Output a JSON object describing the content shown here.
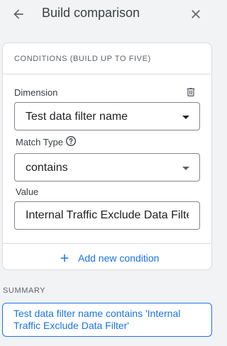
{
  "header": {
    "title": "Build comparison",
    "back_icon": "arrow-back-icon",
    "close_icon": "close-icon"
  },
  "conditions": {
    "heading": "CONDITIONS (BUILD UP TO FIVE)",
    "dimension": {
      "label": "Dimension",
      "selected": "Test data filter name",
      "delete_icon": "trash-icon"
    },
    "match_type": {
      "label": "Match Type",
      "help_icon": "help-circle-icon",
      "selected": "contains"
    },
    "value": {
      "label": "Value",
      "current_value": "Internal Traffic Exclude Data Filter"
    },
    "add_button_label": "Add new condition",
    "add_icon": "plus-icon"
  },
  "summary": {
    "heading": "SUMMARY",
    "text": "Test data filter name contains 'Internal Traffic Exclude Data Filter'"
  },
  "colors": {
    "accent": "#1a73e8",
    "background": "#f1f3f4",
    "border": "#dadce0"
  }
}
